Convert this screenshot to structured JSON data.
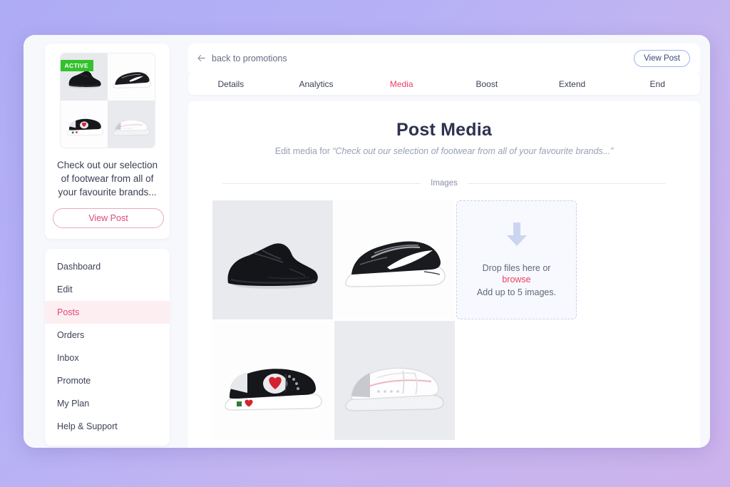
{
  "theme": {
    "accent_pink": "#ef3e63",
    "accent_rose": "#e0467c",
    "active_green": "#33c12c",
    "blue_outline": "#9fb3e8",
    "page_bg_start": "#aeacf5",
    "page_bg_end": "#cdb3ec"
  },
  "sidebar": {
    "promo": {
      "badge": "ACTIVE",
      "title": "Check out our selection of footwear from all of your favourite brands...",
      "view_post_label": "View Post",
      "thumbnails": [
        {
          "alt": "black-running-shoe"
        },
        {
          "alt": "nike-zoom-fly-shoe"
        },
        {
          "alt": "black-heart-sneaker"
        },
        {
          "alt": "white-adidas-continental"
        }
      ]
    },
    "nav": {
      "items": [
        {
          "label": "Dashboard",
          "active": false
        },
        {
          "label": "Edit",
          "active": false
        },
        {
          "label": "Posts",
          "active": true
        },
        {
          "label": "Orders",
          "active": false
        },
        {
          "label": "Inbox",
          "active": false
        },
        {
          "label": "Promote",
          "active": false
        },
        {
          "label": "My Plan",
          "active": false
        },
        {
          "label": "Help & Support",
          "active": false
        }
      ]
    }
  },
  "topbar": {
    "back_label": "back to promotions",
    "back_icon": "arrow-left-icon",
    "view_post_label": "View Post"
  },
  "tabs": [
    {
      "label": "Details",
      "active": false
    },
    {
      "label": "Analytics",
      "active": false
    },
    {
      "label": "Media",
      "active": true
    },
    {
      "label": "Boost",
      "active": false
    },
    {
      "label": "Extend",
      "active": false
    },
    {
      "label": "End",
      "active": false
    }
  ],
  "main": {
    "title": "Post Media",
    "subtitle_prefix": "Edit media for ",
    "subtitle_quote": "“Check out our selection of footwear from all of your favourite brands...”",
    "section_label": "Images",
    "images": [
      {
        "alt": "black-running-shoe"
      },
      {
        "alt": "nike-zoom-fly-shoe"
      },
      {
        "alt": "black-heart-sneaker"
      },
      {
        "alt": "white-adidas-continental"
      }
    ],
    "dropzone": {
      "icon": "download-arrow-icon",
      "line1": "Drop files here or",
      "browse": "browse",
      "line3": "Add up to 5 images."
    }
  }
}
